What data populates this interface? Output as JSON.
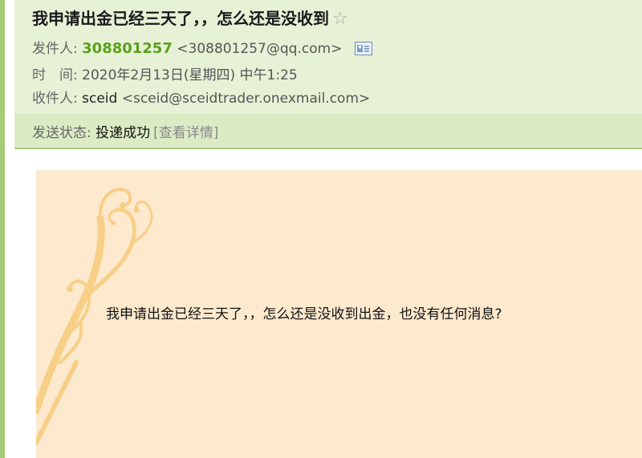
{
  "email": {
    "subject": "我申请出金已经三天了，，怎么还是没收到",
    "star_icon": "star-outline-icon",
    "sender_label": "发件人:",
    "sender_name": "308801257",
    "sender_email": "<308801257@qq.com>",
    "contact_icon": "contact-card-icon",
    "time_label": "时　间:",
    "time_value": "2020年2月13日(星期四) 中午1:25",
    "recipient_label": "收件人:",
    "recipient_name": "sceid",
    "recipient_email": "<sceid@sceidtrader.onexmail.com>",
    "status_label": "发送状态:",
    "status_value": "投递成功",
    "status_detail": "[查看详情]",
    "body": "我申请出金已经三天了，，怎么还是没收到出金，也没有任何消息?"
  },
  "colors": {
    "header_bg": "#e7f1d6",
    "status_bg": "#dcebc4",
    "sender_accent": "#5aa01c",
    "body_bg": "#fde9cd",
    "swirl": "#f7cf86"
  }
}
